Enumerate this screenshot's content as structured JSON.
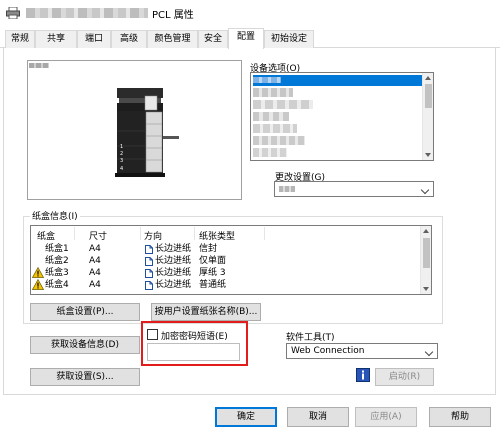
{
  "window": {
    "title": "PCL 属性",
    "title_prefix_redacted": true
  },
  "tabs": [
    {
      "label": "常规"
    },
    {
      "label": "共享"
    },
    {
      "label": "端口"
    },
    {
      "label": "高级"
    },
    {
      "label": "颜色管理"
    },
    {
      "label": "安全"
    },
    {
      "label": "配置",
      "active": true
    },
    {
      "label": "初始设定"
    }
  ],
  "device_options": {
    "label": "设备选项(O)",
    "change_setting_label": "更改设置(G)"
  },
  "paper_tray": {
    "label": "纸盒信息(I)",
    "columns": [
      "纸盒",
      "尺寸",
      "方向",
      "纸张类型"
    ],
    "rows": [
      {
        "tray": "纸盒1",
        "size": "A4",
        "orientation": "长边进纸",
        "type": "信封",
        "warning": false
      },
      {
        "tray": "纸盒2",
        "size": "A4",
        "orientation": "长边进纸",
        "type": "仅单面",
        "warning": false
      },
      {
        "tray": "纸盒3",
        "size": "A4",
        "orientation": "长边进纸",
        "type": "厚纸 3",
        "warning": true
      },
      {
        "tray": "纸盒4",
        "size": "A4",
        "orientation": "长边进纸",
        "type": "普通纸",
        "warning": true
      }
    ],
    "tray_settings_button": "纸盒设置(P)...",
    "user_paper_name_button": "按用户设置纸张名称(B)..."
  },
  "device_info": {
    "get_device_info_button": "获取设备信息(D)",
    "get_settings_button": "获取设置(S)..."
  },
  "encryption": {
    "checkbox_label": "加密密码短语(E)",
    "checked": false,
    "passphrase_value": ""
  },
  "software_tools": {
    "label": "软件工具(T)",
    "selected": "Web Connection",
    "start_button": "启动(R)"
  },
  "footer": {
    "ok": "确定",
    "cancel": "取消",
    "apply": "应用(A)",
    "help": "帮助"
  },
  "colors": {
    "accent": "#0078d7",
    "highlight_box": "#e21b1b",
    "warning": "#f2c500"
  },
  "icons": {
    "app": "printer-icon",
    "orientation": "portrait-page-icon",
    "warning": "warning-triangle-icon",
    "info": "info-icon"
  }
}
